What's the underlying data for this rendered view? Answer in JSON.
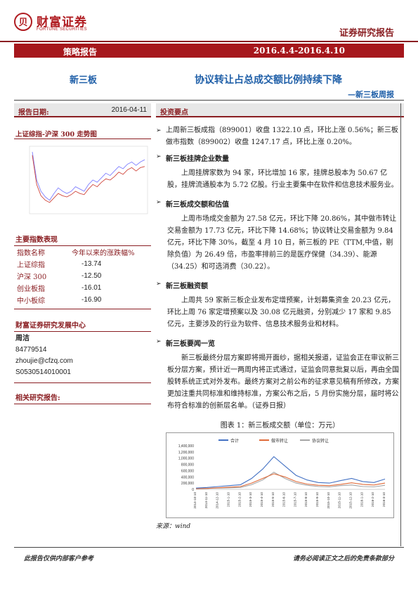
{
  "header": {
    "logo_cn": "财富证券",
    "logo_en": "FORTUNE SECURITIES",
    "report_type": "证券研究报告",
    "category": "策略报告",
    "date_range": "2016.4.4-2016.4.10",
    "sector": "新三板",
    "title": "协议转让占总成交额比例持续下降",
    "subtitle": "—新三板周报"
  },
  "left": {
    "report_date_label": "报告日期:",
    "report_date": "2016-04-11",
    "trend_title": "上证综指-沪深 300 走势图",
    "main_idx_title": "主要指数表现",
    "idx_header": [
      "指数名称",
      "今年以来的涨跌幅%"
    ],
    "indices": [
      {
        "name": "上证综指",
        "value": "-13.74"
      },
      {
        "name": "沪深 300",
        "value": "-12.50"
      },
      {
        "name": "创业板指",
        "value": "-16.01"
      },
      {
        "name": "中小板综",
        "value": "-16.90"
      }
    ],
    "center_title": "财富证券研究发展中心",
    "analyst_name": "周洁",
    "phone": "84779514",
    "email": "zhoujie@cfzq.com",
    "cert": "S0530514010001",
    "related_title": "相关研究报告:",
    "chart_colors": {
      "a": "#7f7fff",
      "b": "#d0463c"
    }
  },
  "right": {
    "key_points_title": "投资要点",
    "intro": "上周新三板成指（899001）收盘 1322.10 点，环比上涨 0.56%；新三板做市指数（899002）收盘 1247.17 点，环比上涨 0.20%。",
    "sections": [
      {
        "heading": "新三板挂牌企业数量",
        "text": "上周挂牌家数为 94 家，环比增加 16 家，挂牌总股本为 50.67 亿股，挂牌流通股本为 5.72 亿股。行业主要集中在软件和信息技术服务业。"
      },
      {
        "heading": "新三板成交额和估值",
        "text": "上周市场成交金额为 27.58 亿元，环比下降 20.86%，其中做市转让交易金额为 17.73 亿元，环比下降 14.68%；协议转让交易金额为 9.84 亿元，环比下降 30%，截至 4 月 10 日，新三板的 PE（TTM,中值，剔除负值）为 26.49 倍，市盈率排前三的是医疗保健（34.39）、能源（34.25）和可选消费（30.22）。"
      },
      {
        "heading": "新三板融资额",
        "text": "上周共 59 家新三板企业发布定增预案，计划募集资金 20.23 亿元，环比上周 76 家定增预案以及 30.08 亿元融资，分别减少 17 家和 9.85 亿元，主要涉及的行业为软件、信息技术服务业和材料。"
      },
      {
        "heading": "新三板要闻一览",
        "text": "新三板最终分层方案即将揭开面纱，据相关报道，证监会正在审议新三板分层方案，预计近一两周内将正式通过，证监会同意批复以后，再由全国股转系统正式对外发布。最终方案对之前公布的征求意见稿有所修改，方案更加注重共同标准和维持标准，方案公布之后，5 月份实施分层，届时将公布符合标准的创新层名单。（证券日报）"
      }
    ],
    "figure_caption": "图表 1：新三板成交额（单位：万元）",
    "source": "来源：wind"
  },
  "chart_data": {
    "type": "line",
    "title": "",
    "xlabel": "",
    "ylabel": "",
    "ylim": [
      0,
      1400000
    ],
    "yticks": [
      "0",
      "200,000",
      "400,000",
      "600,000",
      "800,000",
      "1,000,000",
      "1,200,000",
      "1,400,000"
    ],
    "x": [
      "2014-10-10",
      "2014-11-10",
      "2014-12-10",
      "2015-1-10",
      "2015-2-10",
      "2015-3-10",
      "2015-4-10",
      "2015-5-10",
      "2015-6-10",
      "2015-7-10",
      "2015-8-10",
      "2015-9-10",
      "2015-10-10",
      "2015-11-10",
      "2015-12-10",
      "2016-1-10",
      "2016-2-10",
      "2016-3-10"
    ],
    "series": [
      {
        "name": "合计",
        "color": "#4472c4",
        "values": [
          40000,
          60000,
          90000,
          120000,
          150000,
          350000,
          650000,
          1050000,
          750000,
          450000,
          300000,
          220000,
          200000,
          280000,
          350000,
          250000,
          220000,
          330000
        ]
      },
      {
        "name": "做市转让",
        "color": "#e06b3a",
        "values": [
          20000,
          30000,
          50000,
          70000,
          90000,
          200000,
          350000,
          500000,
          400000,
          250000,
          170000,
          130000,
          120000,
          160000,
          210000,
          160000,
          140000,
          200000
        ]
      },
      {
        "name": "协议转让",
        "color": "#a5a5a5",
        "values": [
          20000,
          30000,
          40000,
          50000,
          60000,
          150000,
          300000,
          550000,
          350000,
          200000,
          130000,
          90000,
          80000,
          120000,
          140000,
          90000,
          80000,
          130000
        ]
      }
    ],
    "legend": "top"
  }
}
